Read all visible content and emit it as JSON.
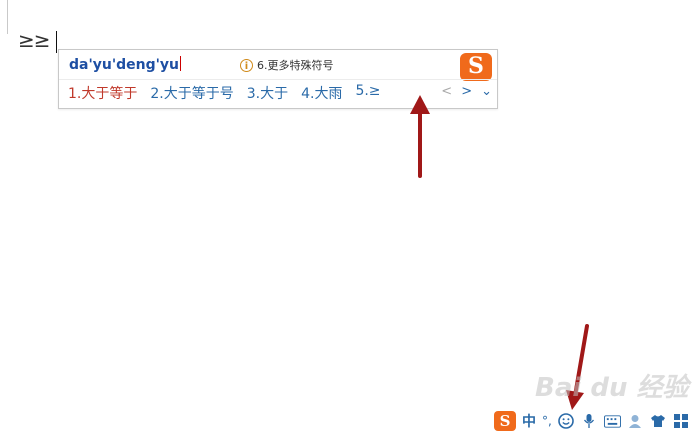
{
  "document": {
    "text": "≥≥"
  },
  "ime": {
    "pinyin": "da'yu'deng'yu",
    "hint": "6.更多特殊符号",
    "hint_icon": "info-icon",
    "logo_letter": "S",
    "candidates": [
      {
        "index": "1.",
        "text": "大于等于"
      },
      {
        "index": "2.",
        "text": "大于等于号"
      },
      {
        "index": "3.",
        "text": "大于"
      },
      {
        "index": "4.",
        "text": "大雨"
      },
      {
        "index": "5.",
        "text": "≥"
      }
    ],
    "nav": {
      "prev": "<",
      "next": ">",
      "expand": "⌄"
    }
  },
  "taskbar": {
    "logo_letter": "S",
    "mode": "中",
    "punct": "°,",
    "icons": [
      "smiley-icon",
      "microphone-icon",
      "keyboard-icon",
      "user-icon",
      "shirt-icon",
      "grid-icon"
    ]
  },
  "watermark": {
    "text": "Bai du 经验"
  },
  "colors": {
    "brand": "#f06a1b",
    "candidate_blue": "#2a6aa8",
    "first_candidate": "#c0392b",
    "arrow": "#a01818"
  }
}
